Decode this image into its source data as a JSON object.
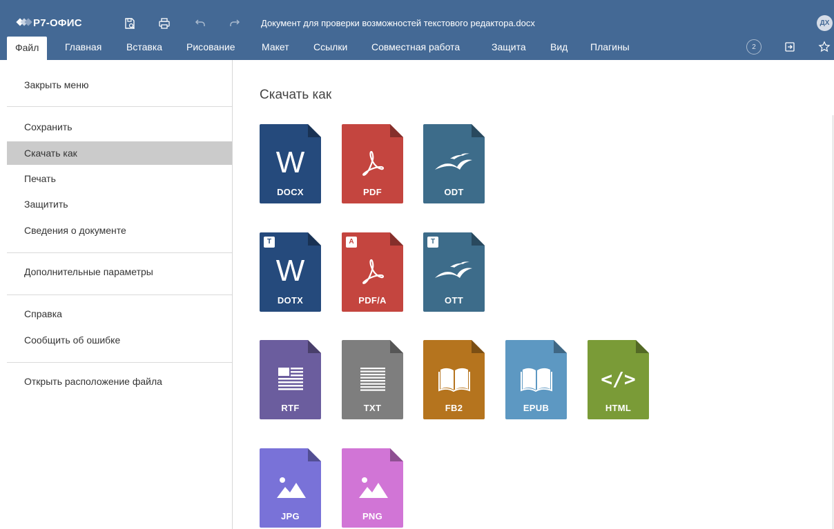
{
  "app": {
    "logo": "Р7-ОФИС",
    "document_title": "Документ для проверки возможностей текстового редактора.docx",
    "user_initials": "ДХ",
    "collaborators_count": "2",
    "colors": {
      "header": "#446995",
      "menu_active": "#cbcbcb"
    }
  },
  "toolbar": {
    "icons": [
      "save-icon",
      "print-icon",
      "undo-icon",
      "redo-icon"
    ]
  },
  "tabs": [
    {
      "label": "Файл",
      "active": true
    },
    {
      "label": "Главная"
    },
    {
      "label": "Вставка"
    },
    {
      "label": "Рисование"
    },
    {
      "label": "Макет"
    },
    {
      "label": "Ссылки"
    },
    {
      "label": "Совместная работа"
    },
    {
      "label": "Защита"
    },
    {
      "label": "Вид"
    },
    {
      "label": "Плагины"
    }
  ],
  "file_menu": [
    {
      "label": "Закрыть меню"
    },
    {
      "label": "Сохранить"
    },
    {
      "label": "Скачать как",
      "active": true
    },
    {
      "label": "Печать"
    },
    {
      "label": "Защитить"
    },
    {
      "label": "Сведения о документе"
    },
    {
      "label": "Дополнительные параметры"
    },
    {
      "label": "Справка"
    },
    {
      "label": "Сообщить об ошибке"
    },
    {
      "label": "Открыть расположение файла"
    }
  ],
  "download": {
    "title": "Скачать как",
    "formats": [
      {
        "label": "DOCX",
        "color": "#254a7c",
        "icon": "word-icon",
        "glyph": "W"
      },
      {
        "label": "PDF",
        "color": "#c4453f",
        "icon": "pdf-icon"
      },
      {
        "label": "ODT",
        "color": "#3d6c8a",
        "icon": "gull-icon"
      },
      {
        "label": "DOTX",
        "color": "#254a7c",
        "icon": "word-icon",
        "glyph": "W",
        "badge": "T"
      },
      {
        "label": "PDF/A",
        "color": "#c4453f",
        "icon": "pdf-icon",
        "badge": "A"
      },
      {
        "label": "OTT",
        "color": "#3d6c8a",
        "icon": "gull-icon",
        "badge": "T"
      },
      {
        "label": "RTF",
        "color": "#6b5d9e",
        "icon": "rtf-icon"
      },
      {
        "label": "TXT",
        "color": "#7e7e7e",
        "icon": "text-lines-icon"
      },
      {
        "label": "FB2",
        "color": "#b5741e",
        "icon": "book-icon"
      },
      {
        "label": "EPUB",
        "color": "#5d98c2",
        "icon": "book-icon"
      },
      {
        "label": "HTML",
        "color": "#7a9b37",
        "icon": "code-icon",
        "glyph": "</>"
      },
      {
        "label": "JPG",
        "color": "#7972d8",
        "icon": "image-icon"
      },
      {
        "label": "PNG",
        "color": "#d175d6",
        "icon": "image-icon"
      }
    ]
  }
}
